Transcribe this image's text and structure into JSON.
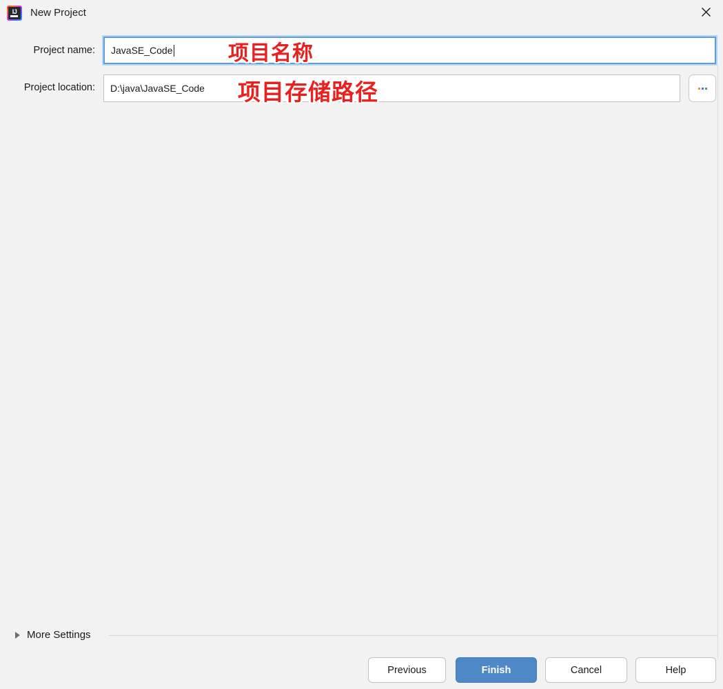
{
  "window": {
    "title": "New Project",
    "app_icon": "intellij-idea-icon",
    "close_icon": "close-icon"
  },
  "form": {
    "project_name": {
      "label": "Project name:",
      "value": "JavaSE_Code",
      "placeholder": "",
      "focused": true
    },
    "project_location": {
      "label": "Project location:",
      "value": "D:\\java\\JavaSE_Code",
      "placeholder": "",
      "focused": false
    },
    "browse_button": {
      "label": "...",
      "icon": "ellipsis-icon"
    }
  },
  "annotations": [
    {
      "text": "项目名称",
      "color": "#e8211f"
    },
    {
      "text": "项目存储路径",
      "color": "#e8211f"
    }
  ],
  "more_settings": {
    "label": "More Settings",
    "expanded": false,
    "icon": "chevron-right-icon"
  },
  "buttons": {
    "previous": "Previous",
    "finish": "Finish",
    "cancel": "Cancel",
    "help": "Help"
  },
  "colors": {
    "background": "#f2f2f2",
    "focus_border": "#5c9ddb",
    "focus_glow": "#b8d7f2",
    "primary_button": "#4f88c6",
    "annotation_red": "#e8211f"
  }
}
